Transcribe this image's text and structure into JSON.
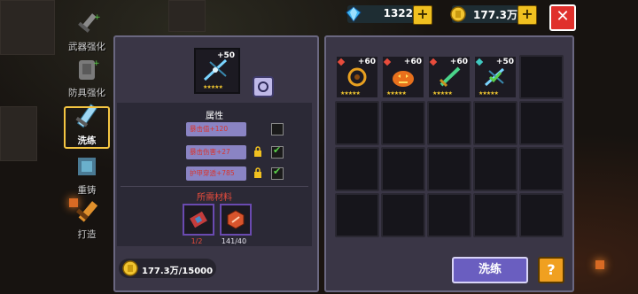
{
  "header": {
    "gems": {
      "value": "1322",
      "plus": "+"
    },
    "coins": {
      "value": "177.3万",
      "plus": "+"
    },
    "close_label": "✕"
  },
  "nav": {
    "items": [
      {
        "label": "武器强化",
        "icon": "weapon-upgrade-icon",
        "active": false
      },
      {
        "label": "防具强化",
        "icon": "armor-upgrade-icon",
        "active": false
      },
      {
        "label": "洗练",
        "icon": "refine-icon",
        "active": true
      },
      {
        "label": "重铸",
        "icon": "recast-icon",
        "active": false
      },
      {
        "label": "打造",
        "icon": "forge-icon",
        "active": false
      }
    ]
  },
  "equipped": {
    "plus": "+50",
    "stars": "★★★★★"
  },
  "attributes": {
    "title": "属性",
    "rows": [
      {
        "label": "暴击值+120",
        "locked": false,
        "checked": false
      },
      {
        "label": "暴击伤害+27",
        "locked": true,
        "checked": true
      },
      {
        "label": "护甲穿透+785",
        "locked": true,
        "checked": true
      }
    ]
  },
  "materials": {
    "title": "所需材料",
    "items": [
      {
        "count": "1/2",
        "color": "#e84c3c"
      },
      {
        "count": "141/40",
        "color": "#e8e6f0"
      }
    ]
  },
  "cost": {
    "value": "177.3万/15000"
  },
  "inventory": {
    "items": [
      {
        "plus": "+60",
        "stars": "★★★★★",
        "gem": "#e84c3c"
      },
      {
        "plus": "+60",
        "stars": "★★★★★",
        "gem": "#e84c3c"
      },
      {
        "plus": "+60",
        "stars": "★★★★★",
        "gem": "#e84c3c"
      },
      {
        "plus": "+50",
        "stars": "★★★★★",
        "gem": "#40c8c0"
      }
    ]
  },
  "actions": {
    "wash_label": "洗练",
    "help_label": "?"
  },
  "colors": {
    "accent": "#6a5ec0",
    "gold": "#f0c020",
    "danger": "#e0302c"
  }
}
